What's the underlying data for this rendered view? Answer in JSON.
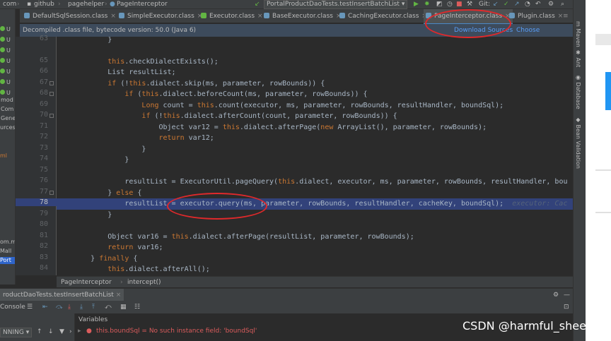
{
  "nav": {
    "crumb_com": "com",
    "crumb_github": "github",
    "crumb_pagehelper": "pagehelper",
    "crumb_class": "PageInterceptor",
    "run_config": "PortalProductDaoTests.testInsertBatchList",
    "git_label": "Git:"
  },
  "tabs": [
    {
      "label": "DefaultSqlSession.class"
    },
    {
      "label": "SimpleExecutor.class"
    },
    {
      "label": "Executor.class"
    },
    {
      "label": "BaseExecutor.class"
    },
    {
      "label": "CachingExecutor.class"
    },
    {
      "label": "PageInterceptor.class"
    },
    {
      "label": "Plugin.class"
    }
  ],
  "banner": {
    "text": "Decompiled .class file, bytecode version: 50.0 (Java 6)",
    "download_link": "Download Sources",
    "choose_link": "Choose Sources..."
  },
  "left_panel": {
    "rows": [
      "U",
      "U",
      "U",
      "U",
      "U",
      "U",
      "U",
      "mod",
      "Com",
      "Gene",
      "urces",
      "ml",
      "om.m",
      "Mall",
      "Port"
    ]
  },
  "editor": {
    "current_line": "78",
    "hint": "executor: Cac",
    "line_numbers": [
      "63",
      "",
      "65",
      "66",
      "67",
      "68",
      "69",
      "70",
      "71",
      "72",
      "73",
      "74",
      "75",
      "76",
      "77",
      "78",
      "79",
      "80",
      "81",
      "82",
      "83",
      "84"
    ]
  },
  "breadcrumb": {
    "class": "PageInterceptor",
    "method": "intercept()"
  },
  "run_panel": {
    "tab": "roductDaoTests.testInsertBatchList",
    "console_label": "Console",
    "state": "NNING",
    "variables_label": "Variables",
    "var_row": "this.boundSql = No such instance field: 'boundSql'"
  },
  "tool_windows": [
    "Maven",
    "Ant",
    "Database",
    "Bean Validation"
  ],
  "watermark": "CSDN @harmful_sheep",
  "colors": {
    "keyword": "#cc7832",
    "method": "#ffc66d",
    "plain": "#a9b7c6",
    "highlight_line": "#32427a",
    "annotation_circle": "#e0292b"
  }
}
